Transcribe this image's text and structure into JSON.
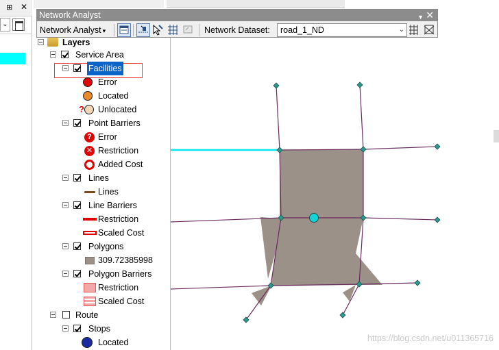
{
  "network_analyst": {
    "title": "Network Analyst",
    "menu_label": "Network Analyst",
    "dataset_label": "Network Dataset:",
    "dataset_value": "road_1_ND"
  },
  "toc": {
    "root": "Layers",
    "service_area": "Service Area",
    "facilities": "Facilities",
    "facilities_items": [
      "Error",
      "Located",
      "Unlocated"
    ],
    "point_barriers": "Point Barriers",
    "point_barriers_items": [
      "Error",
      "Restriction",
      "Added Cost"
    ],
    "lines": "Lines",
    "lines_items": [
      "Lines"
    ],
    "line_barriers": "Line Barriers",
    "line_barriers_items": [
      "Restriction",
      "Scaled Cost"
    ],
    "polygons": "Polygons",
    "polygons_items": [
      "309.72385998"
    ],
    "polygon_barriers": "Polygon Barriers",
    "polygon_barriers_items": [
      "Restriction",
      "Scaled Cost"
    ],
    "route": "Route",
    "stops": "Stops",
    "stops_items": [
      "Located"
    ]
  },
  "colors": {
    "selection": "#0a64c8",
    "polygon_fill": "#9c9189",
    "network_line": "#6b2a5e",
    "highlight_line": "#00e5ee",
    "facility": "#12d4d8"
  },
  "watermark": "https://blog.csdn.net/u011365716"
}
